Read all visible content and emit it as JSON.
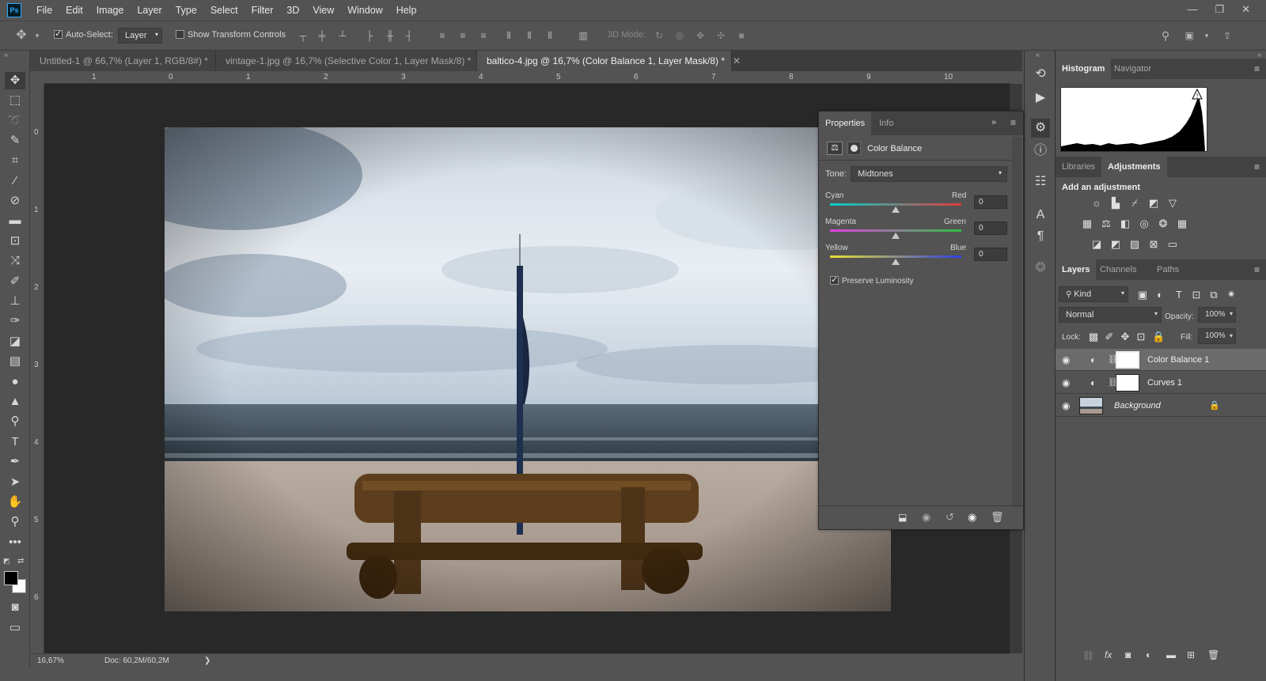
{
  "menu": {
    "logo": "Ps",
    "items": [
      "File",
      "Edit",
      "Image",
      "Layer",
      "Type",
      "Select",
      "Filter",
      "3D",
      "View",
      "Window",
      "Help"
    ],
    "window_controls": [
      "—",
      "❐",
      "✕"
    ]
  },
  "options": {
    "auto_select_label": "Auto-Select:",
    "auto_select_value": "Layer",
    "transform_label": "Show Transform Controls",
    "mode3d_label": "3D Mode:"
  },
  "tabs": [
    {
      "label": "Untitled-1 @ 66,7% (Layer 1, RGB/8#) *",
      "active": false
    },
    {
      "label": "vintage-1.jpg @ 16,7% (Selective Color 1, Layer Mask/8) *",
      "active": false
    },
    {
      "label": "baltico-4.jpg @ 16,7% (Color Balance 1, Layer Mask/8) *",
      "active": true
    }
  ],
  "rulers": {
    "h": [
      "1",
      "0",
      "1",
      "2",
      "3",
      "4",
      "5",
      "6",
      "7",
      "8",
      "9",
      "10"
    ],
    "v": [
      "0",
      "1",
      "2",
      "3",
      "4",
      "5",
      "6"
    ]
  },
  "status": {
    "zoom": "16,67%",
    "doc": "Doc: 60,2M/60,2M",
    "arrow": "❯"
  },
  "properties": {
    "tab_properties": "Properties",
    "tab_info": "Info",
    "title": "Color Balance",
    "tone_label": "Tone:",
    "tone_value": "Midtones",
    "sliders": [
      {
        "left": "Cyan",
        "right": "Red",
        "value": "0"
      },
      {
        "left": "Magenta",
        "right": "Green",
        "value": "0"
      },
      {
        "left": "Yellow",
        "right": "Blue",
        "value": "0"
      }
    ],
    "preserve_label": "Preserve Luminosity"
  },
  "histogram": {
    "tab_histogram": "Histogram",
    "tab_navigator": "Navigator"
  },
  "adjustments": {
    "tab_libraries": "Libraries",
    "tab_adjustments": "Adjustments",
    "heading": "Add an adjustment"
  },
  "layers": {
    "tab_layers": "Layers",
    "tab_channels": "Channels",
    "tab_paths": "Paths",
    "kind": "Kind",
    "blend": "Normal",
    "opacity_label": "Opacity:",
    "opacity_value": "100%",
    "lock_label": "Lock:",
    "fill_label": "Fill:",
    "fill_value": "100%",
    "items": [
      {
        "name": "Color Balance 1",
        "selected": true
      },
      {
        "name": "Curves 1",
        "selected": false
      },
      {
        "name": "Background",
        "selected": false
      }
    ]
  },
  "colors": {
    "accent": "#31a8ff",
    "panel": "#535353",
    "canvas": "#282828"
  }
}
